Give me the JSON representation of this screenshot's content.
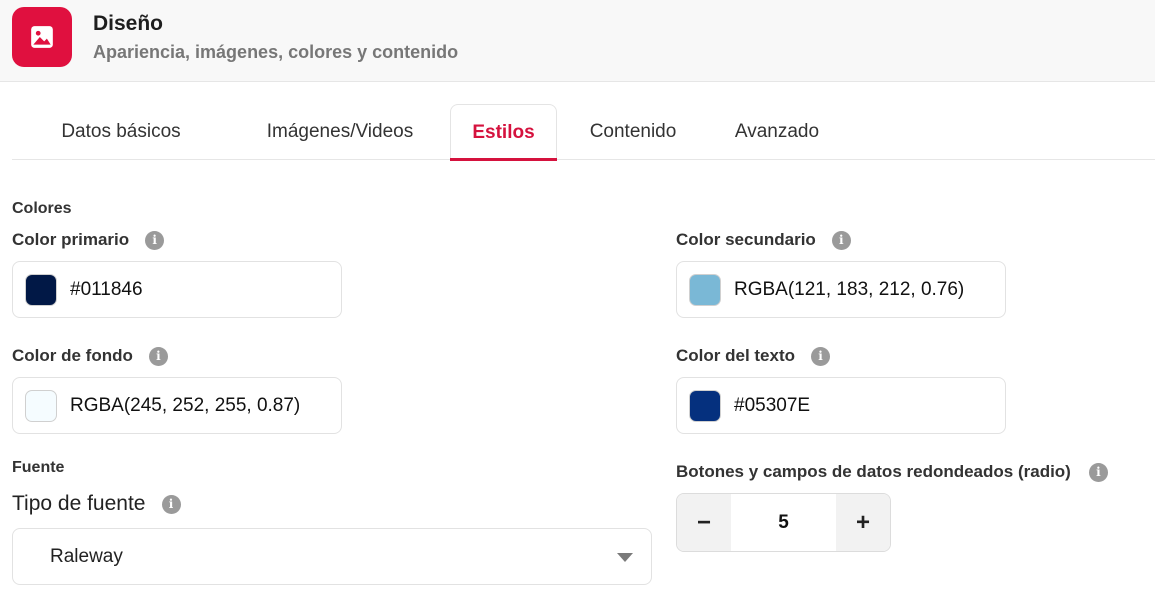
{
  "header": {
    "title": "Diseño",
    "subtitle": "Apariencia, imágenes, colores y contenido",
    "icon": "image-icon",
    "accent": "#e0103f"
  },
  "tabs": [
    {
      "label": "Datos básicos",
      "active": false
    },
    {
      "label": "Imágenes/Videos",
      "active": false
    },
    {
      "label": "Estilos",
      "active": true
    },
    {
      "label": "Contenido",
      "active": false
    },
    {
      "label": "Avanzado",
      "active": false
    }
  ],
  "colors": {
    "section_title": "Colores",
    "primary": {
      "label": "Color primario",
      "value": "#011846",
      "swatch": "#011846"
    },
    "secondary": {
      "label": "Color secundario",
      "value": "RGBA(121, 183, 212, 0.76)",
      "swatch": "#7ab8d6"
    },
    "background": {
      "label": "Color de fondo",
      "value": "RGBA(245, 252, 255, 0.87)",
      "swatch": "#f5fcff"
    },
    "text": {
      "label": "Color del texto",
      "value": "#05307E",
      "swatch": "#05307E"
    }
  },
  "font": {
    "section_title": "Fuente",
    "type_label": "Tipo de fuente",
    "selected": "Raleway"
  },
  "radius": {
    "label": "Botones y campos de datos redondeados (radio)",
    "value": "5",
    "minus": "−",
    "plus": "+"
  },
  "info_glyph": "i"
}
